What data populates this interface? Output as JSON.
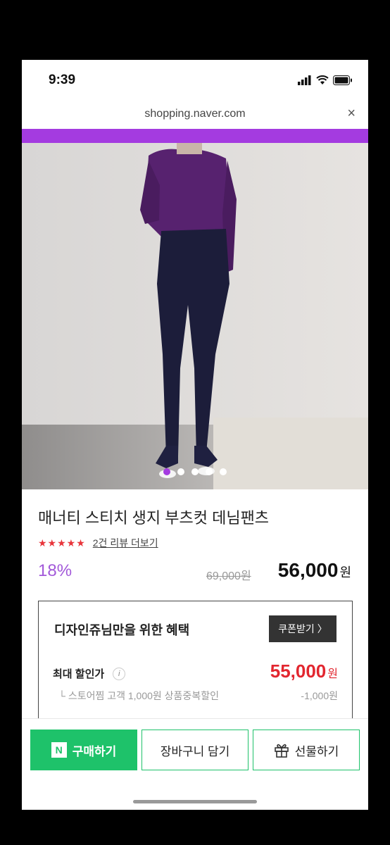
{
  "status_bar": {
    "time": "9:39"
  },
  "browser": {
    "url": "shopping.naver.com",
    "close_label": "×"
  },
  "product": {
    "title": "매너티 스티치 생지 부츠컷 데님팬츠",
    "stars": "★★★★★",
    "review_link": "2건 리뷰 더보기",
    "discount": "18%",
    "original_price": "69,000원",
    "sale_price": "56,000",
    "currency": "원",
    "image_dots": 5,
    "active_dot": 0
  },
  "benefit": {
    "title": "디자인쥬님만을 위한 혜택",
    "coupon_button": "쿠폰받기 〉",
    "max_label": "최대 할인가",
    "info_icon": "i",
    "max_price": "55,000",
    "currency": "원",
    "sub_label": "스토어찜 고객 1,000원 상품중복할인",
    "sub_prefix": "└",
    "sub_amount": "-1,000원"
  },
  "actions": {
    "buy": "구매하기",
    "buy_badge": "N",
    "cart": "장바구니 담기",
    "gift": "선물하기"
  },
  "colors": {
    "accent": "#a43be0",
    "naver_green": "#1ec26a",
    "price_red": "#e2262f"
  }
}
